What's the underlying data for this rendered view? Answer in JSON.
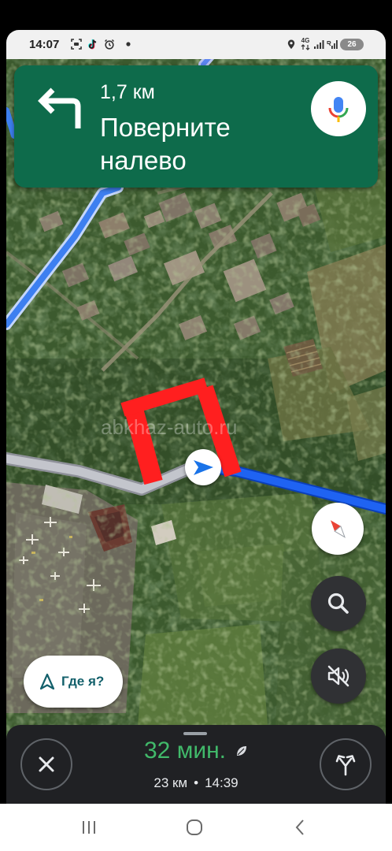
{
  "status_bar": {
    "time": "14:07",
    "network_type": "4G",
    "battery_level": "26",
    "left_icons": [
      "screenshot-icon",
      "tiktok-icon",
      "alarm-icon",
      "notification-dot-icon"
    ],
    "right_icons": [
      "location-icon",
      "signal-icon",
      "signal-icon",
      "battery-icon"
    ]
  },
  "navigation_banner": {
    "maneuver_icon": "turn-left-icon",
    "distance": "1,7 км",
    "instruction": "Поверните налево",
    "mic_icon": "mic-icon",
    "background_color": "#0e6b4b"
  },
  "map": {
    "watermark": "abkhaz-auto.ru",
    "position_icon": "navigation-arrow-icon",
    "route_color": "#1f63f2",
    "traveled_color": "#c3c5cc",
    "annotation_color": "#ff1f1f"
  },
  "map_controls": {
    "compass_icon": "compass-icon",
    "search_icon": "search-icon",
    "sound_icon": "sound-off-icon",
    "where_am_i": {
      "icon": "navigation-outline-icon",
      "label": "Где я?"
    }
  },
  "trip_panel": {
    "close_icon": "close-icon",
    "duration": "32 мин.",
    "duration_color": "#41b96a",
    "eco_icon": "leaf-icon",
    "distance": "23 км",
    "separator": "•",
    "arrival_time": "14:39",
    "routes_icon": "alternate-routes-icon"
  },
  "system_nav": {
    "recent_icon": "recent-apps-icon",
    "home_icon": "home-icon",
    "back_icon": "back-icon"
  }
}
